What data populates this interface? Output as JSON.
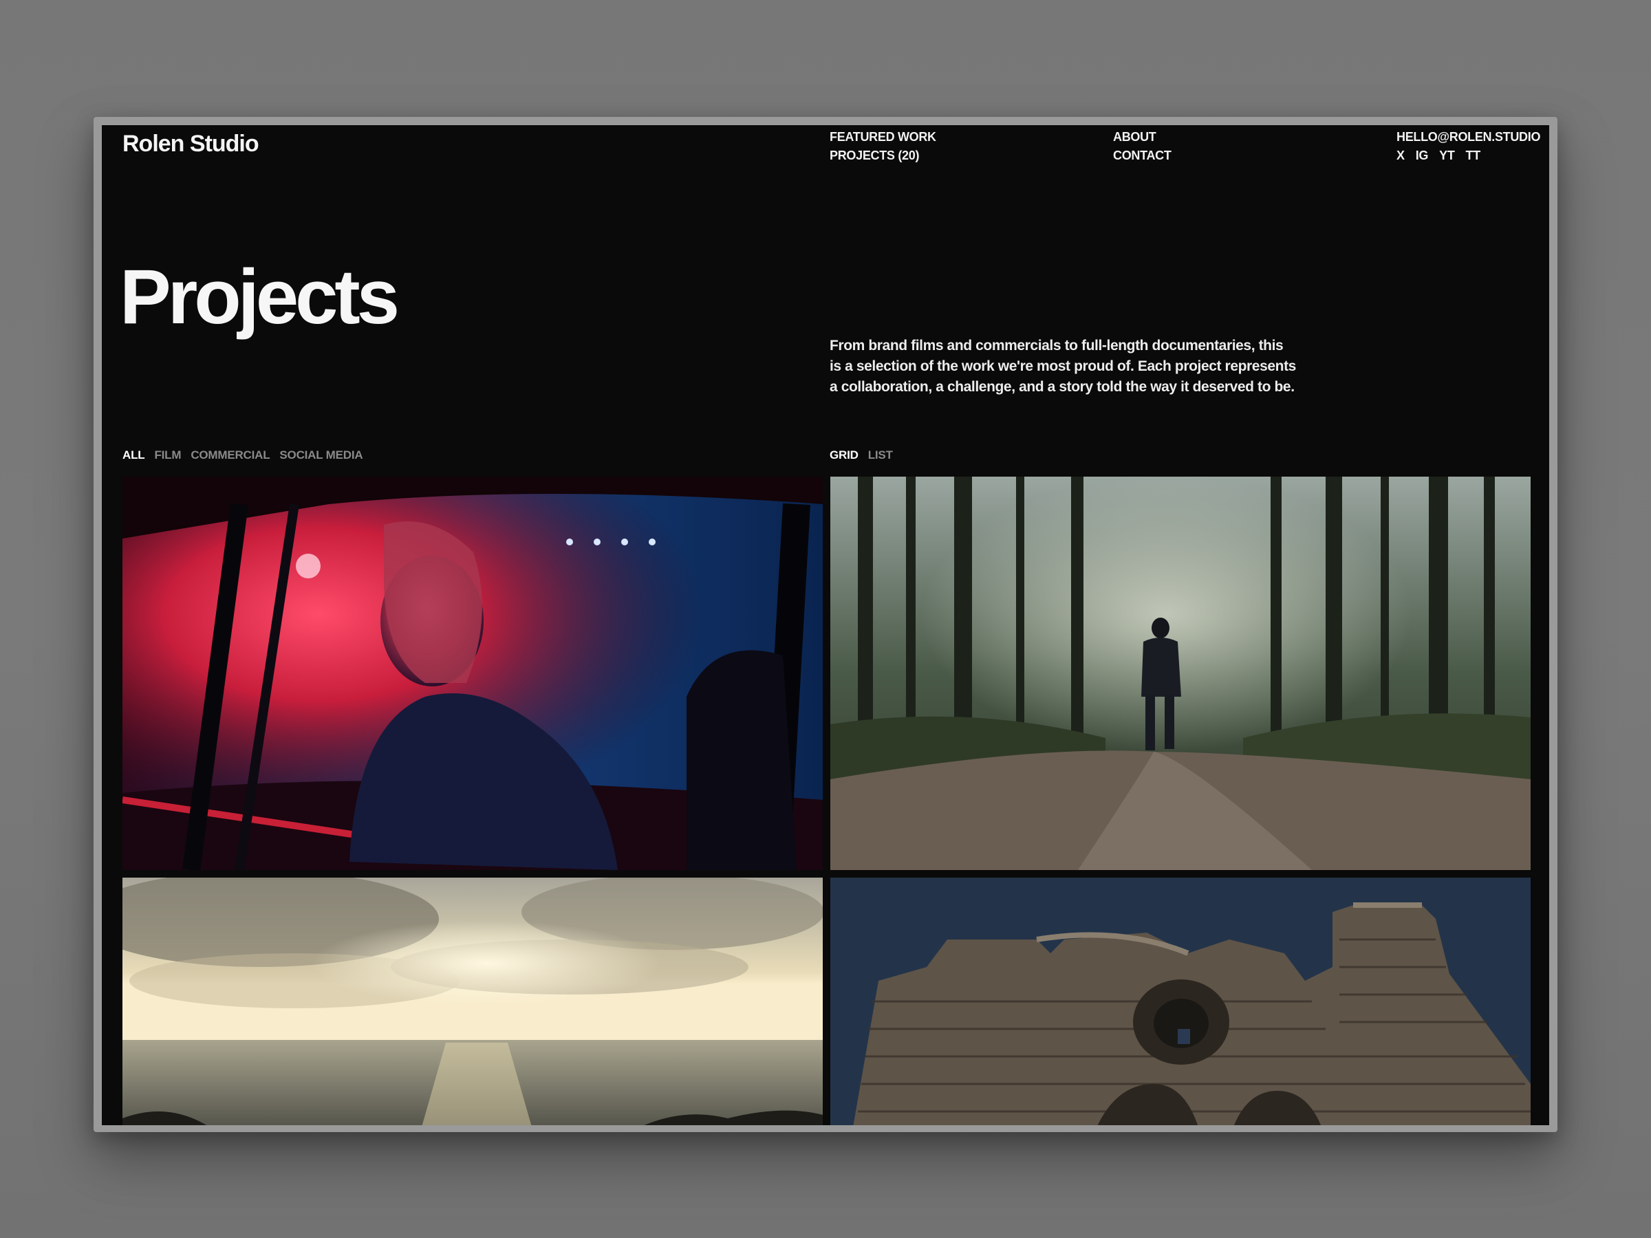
{
  "brand": {
    "logo": "Rolen Studio"
  },
  "nav": {
    "featured_work": "FEATURED WORK",
    "projects": "PROJECTS (20)",
    "about": "ABOUT",
    "contact": "CONTACT",
    "email": "HELLO@ROLEN.STUDIO",
    "social": [
      "X",
      "IG",
      "YT",
      "TT"
    ]
  },
  "hero": {
    "title": "Projects",
    "intro": "From brand films and commercials to full-length documentaries, this is a selection of the work we're most proud of. Each project represents a collaboration, a challenge, and a story told the way it deserved to be."
  },
  "filters": [
    "ALL",
    "FILM",
    "COMMERCIAL",
    "SOCIAL MEDIA"
  ],
  "active_filter": "ALL",
  "views": [
    "GRID",
    "LIST"
  ],
  "active_view": "GRID",
  "colors": {
    "background": "#0a0a0a",
    "text": "#f4f4f4",
    "muted": "#8a8a8a"
  }
}
